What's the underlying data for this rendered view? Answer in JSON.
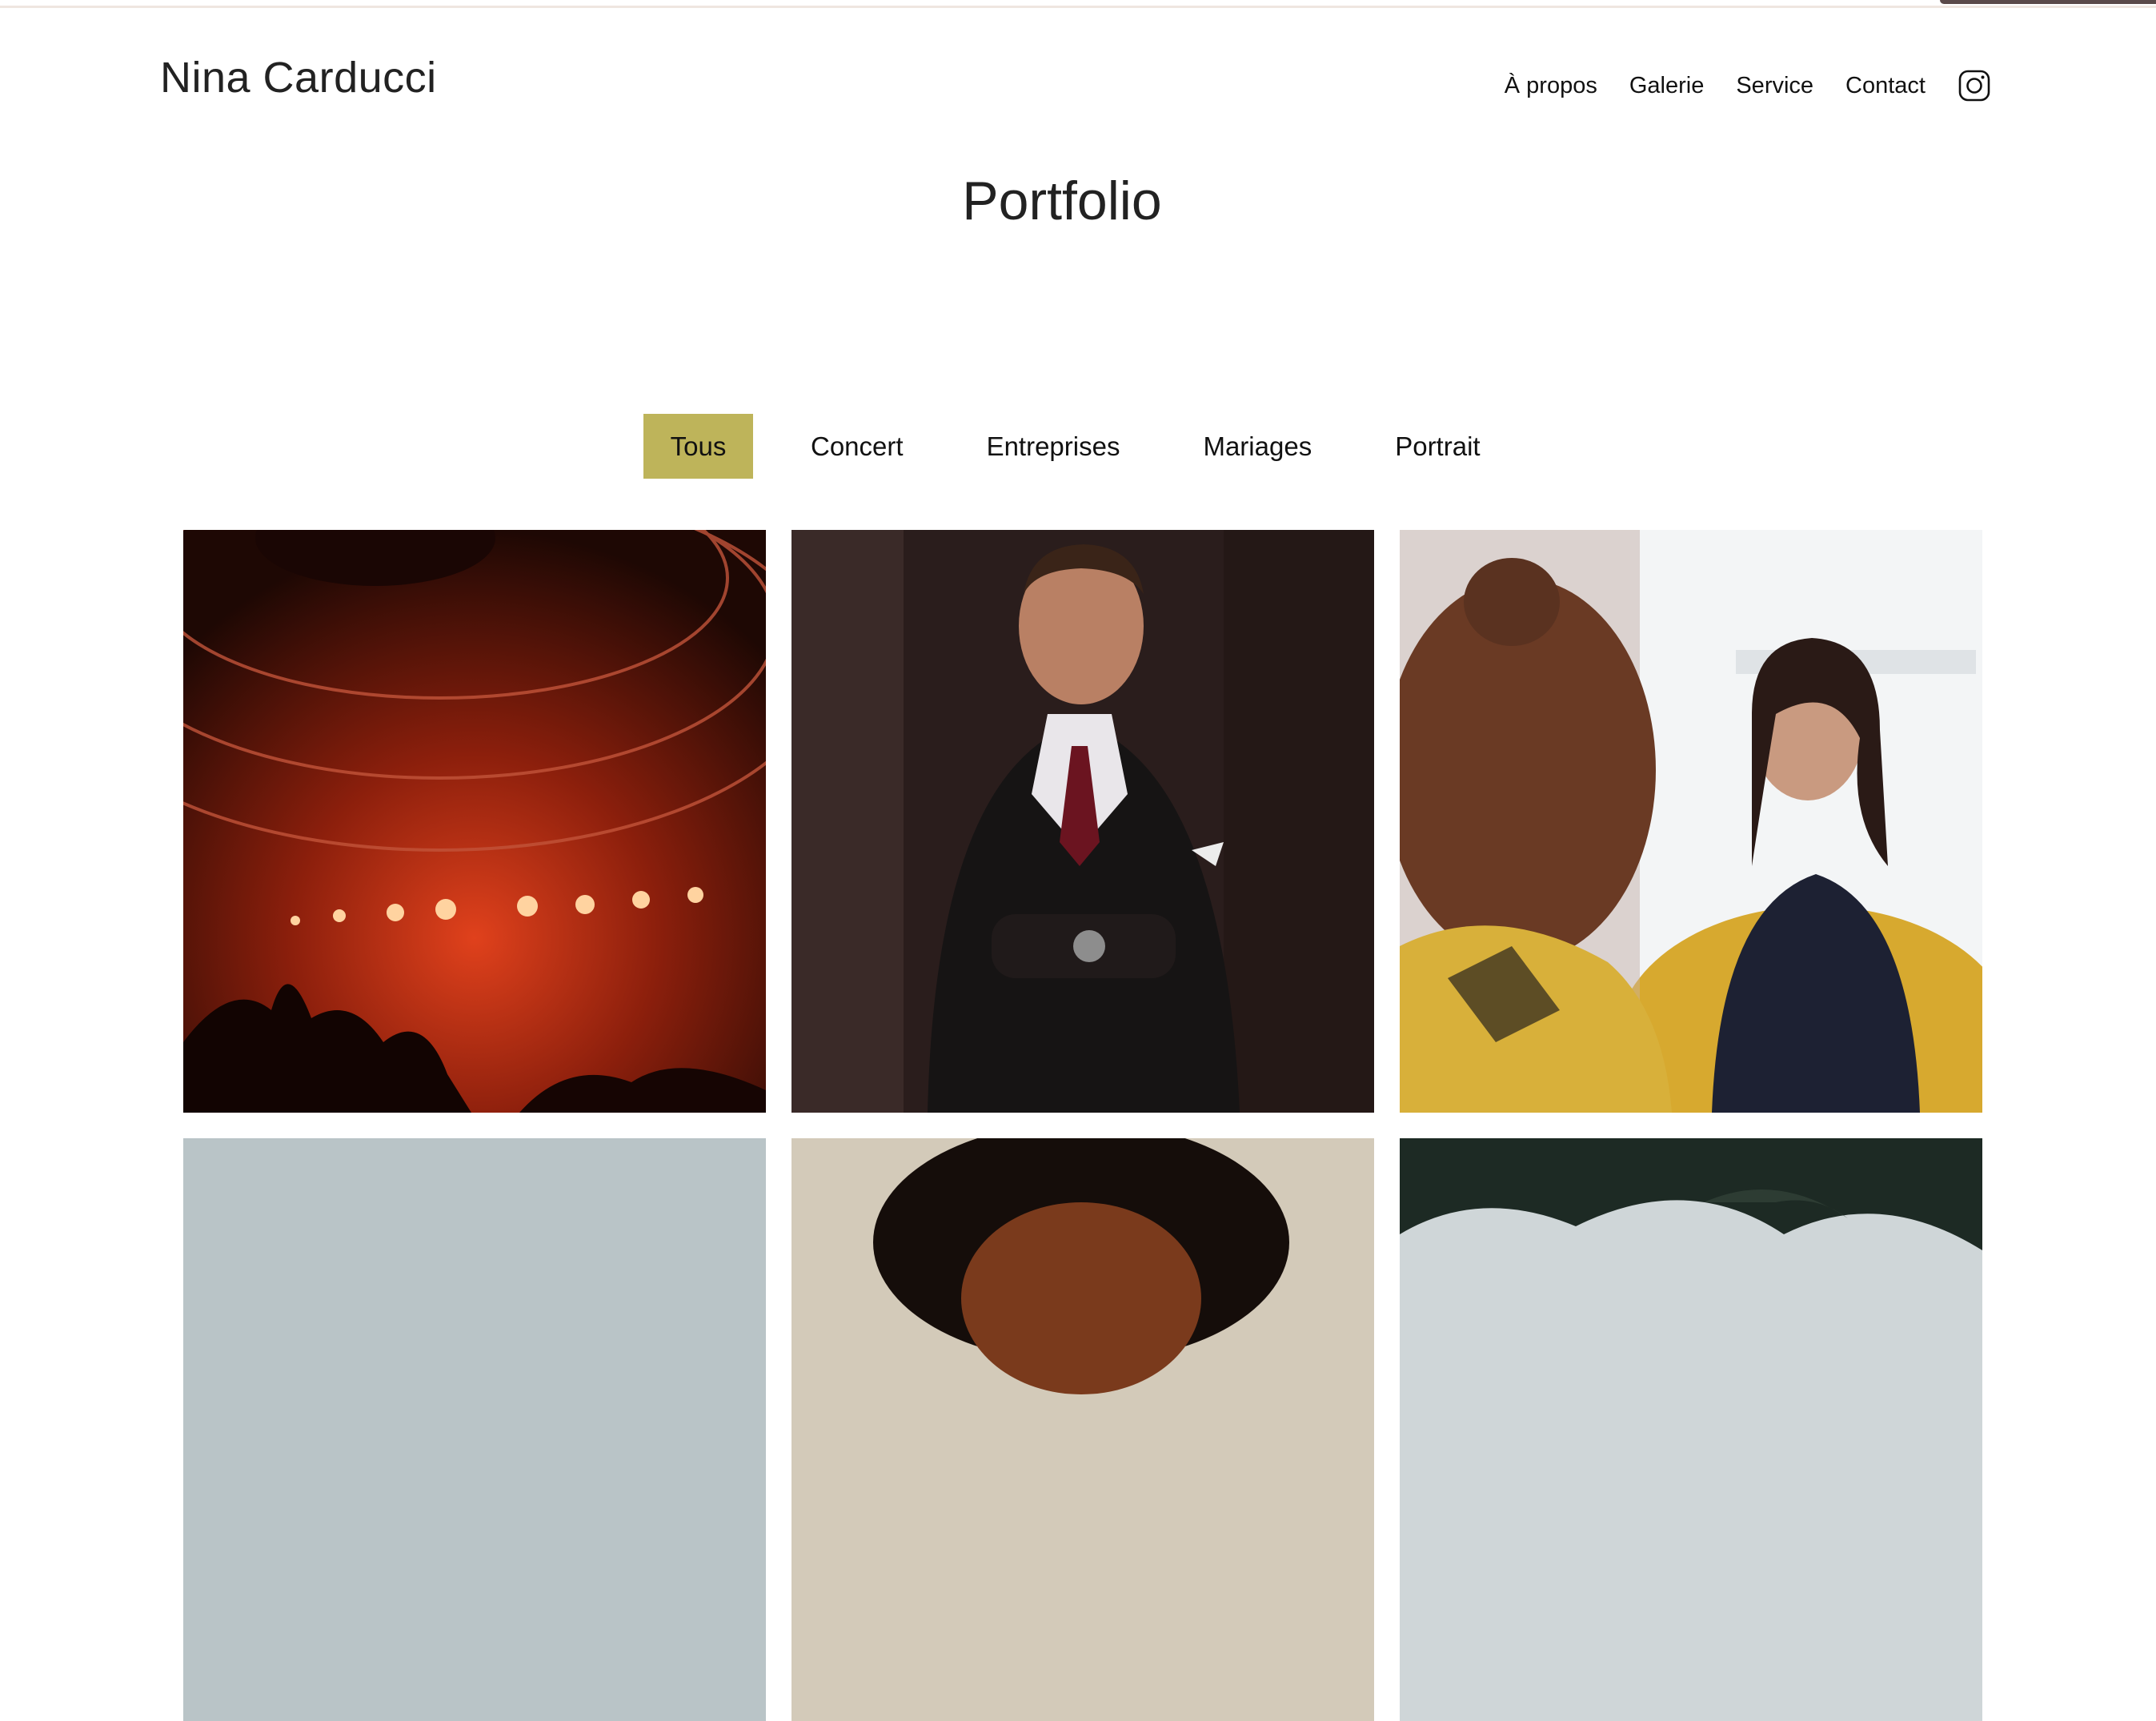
{
  "header": {
    "brand": "Nina Carducci",
    "nav": [
      {
        "label": "À propos"
      },
      {
        "label": "Galerie"
      },
      {
        "label": "Service"
      },
      {
        "label": "Contact"
      }
    ],
    "social_icon": "instagram-icon"
  },
  "page": {
    "title": "Portfolio"
  },
  "filters": {
    "items": [
      {
        "label": "Tous",
        "active": true
      },
      {
        "label": "Concert",
        "active": false
      },
      {
        "label": "Entreprises",
        "active": false
      },
      {
        "label": "Mariages",
        "active": false
      },
      {
        "label": "Portrait",
        "active": false
      }
    ]
  },
  "colors": {
    "accent": "#beb45a",
    "text": "#1f1f1f",
    "background": "#ffffff"
  }
}
